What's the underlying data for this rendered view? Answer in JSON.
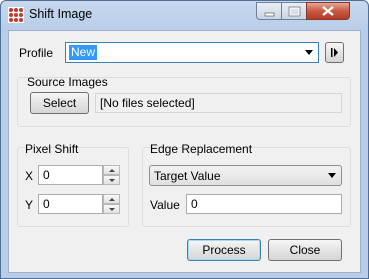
{
  "window": {
    "title": "Shift Image"
  },
  "profile": {
    "label": "Profile",
    "value": "New"
  },
  "source_images": {
    "group_label": "Source Images",
    "select_label": "Select",
    "status": "[No files selected]"
  },
  "pixel_shift": {
    "group_label": "Pixel Shift",
    "x_label": "X",
    "x_value": "0",
    "y_label": "Y",
    "y_value": "0"
  },
  "edge_replacement": {
    "group_label": "Edge Replacement",
    "mode": "Target Value",
    "value_label": "Value",
    "value": "0"
  },
  "buttons": {
    "process": "Process",
    "close": "Close"
  },
  "colors": {
    "selection": "#3399ff",
    "focus_border": "#3c7fb1",
    "window_frame": "#b9cde9"
  }
}
